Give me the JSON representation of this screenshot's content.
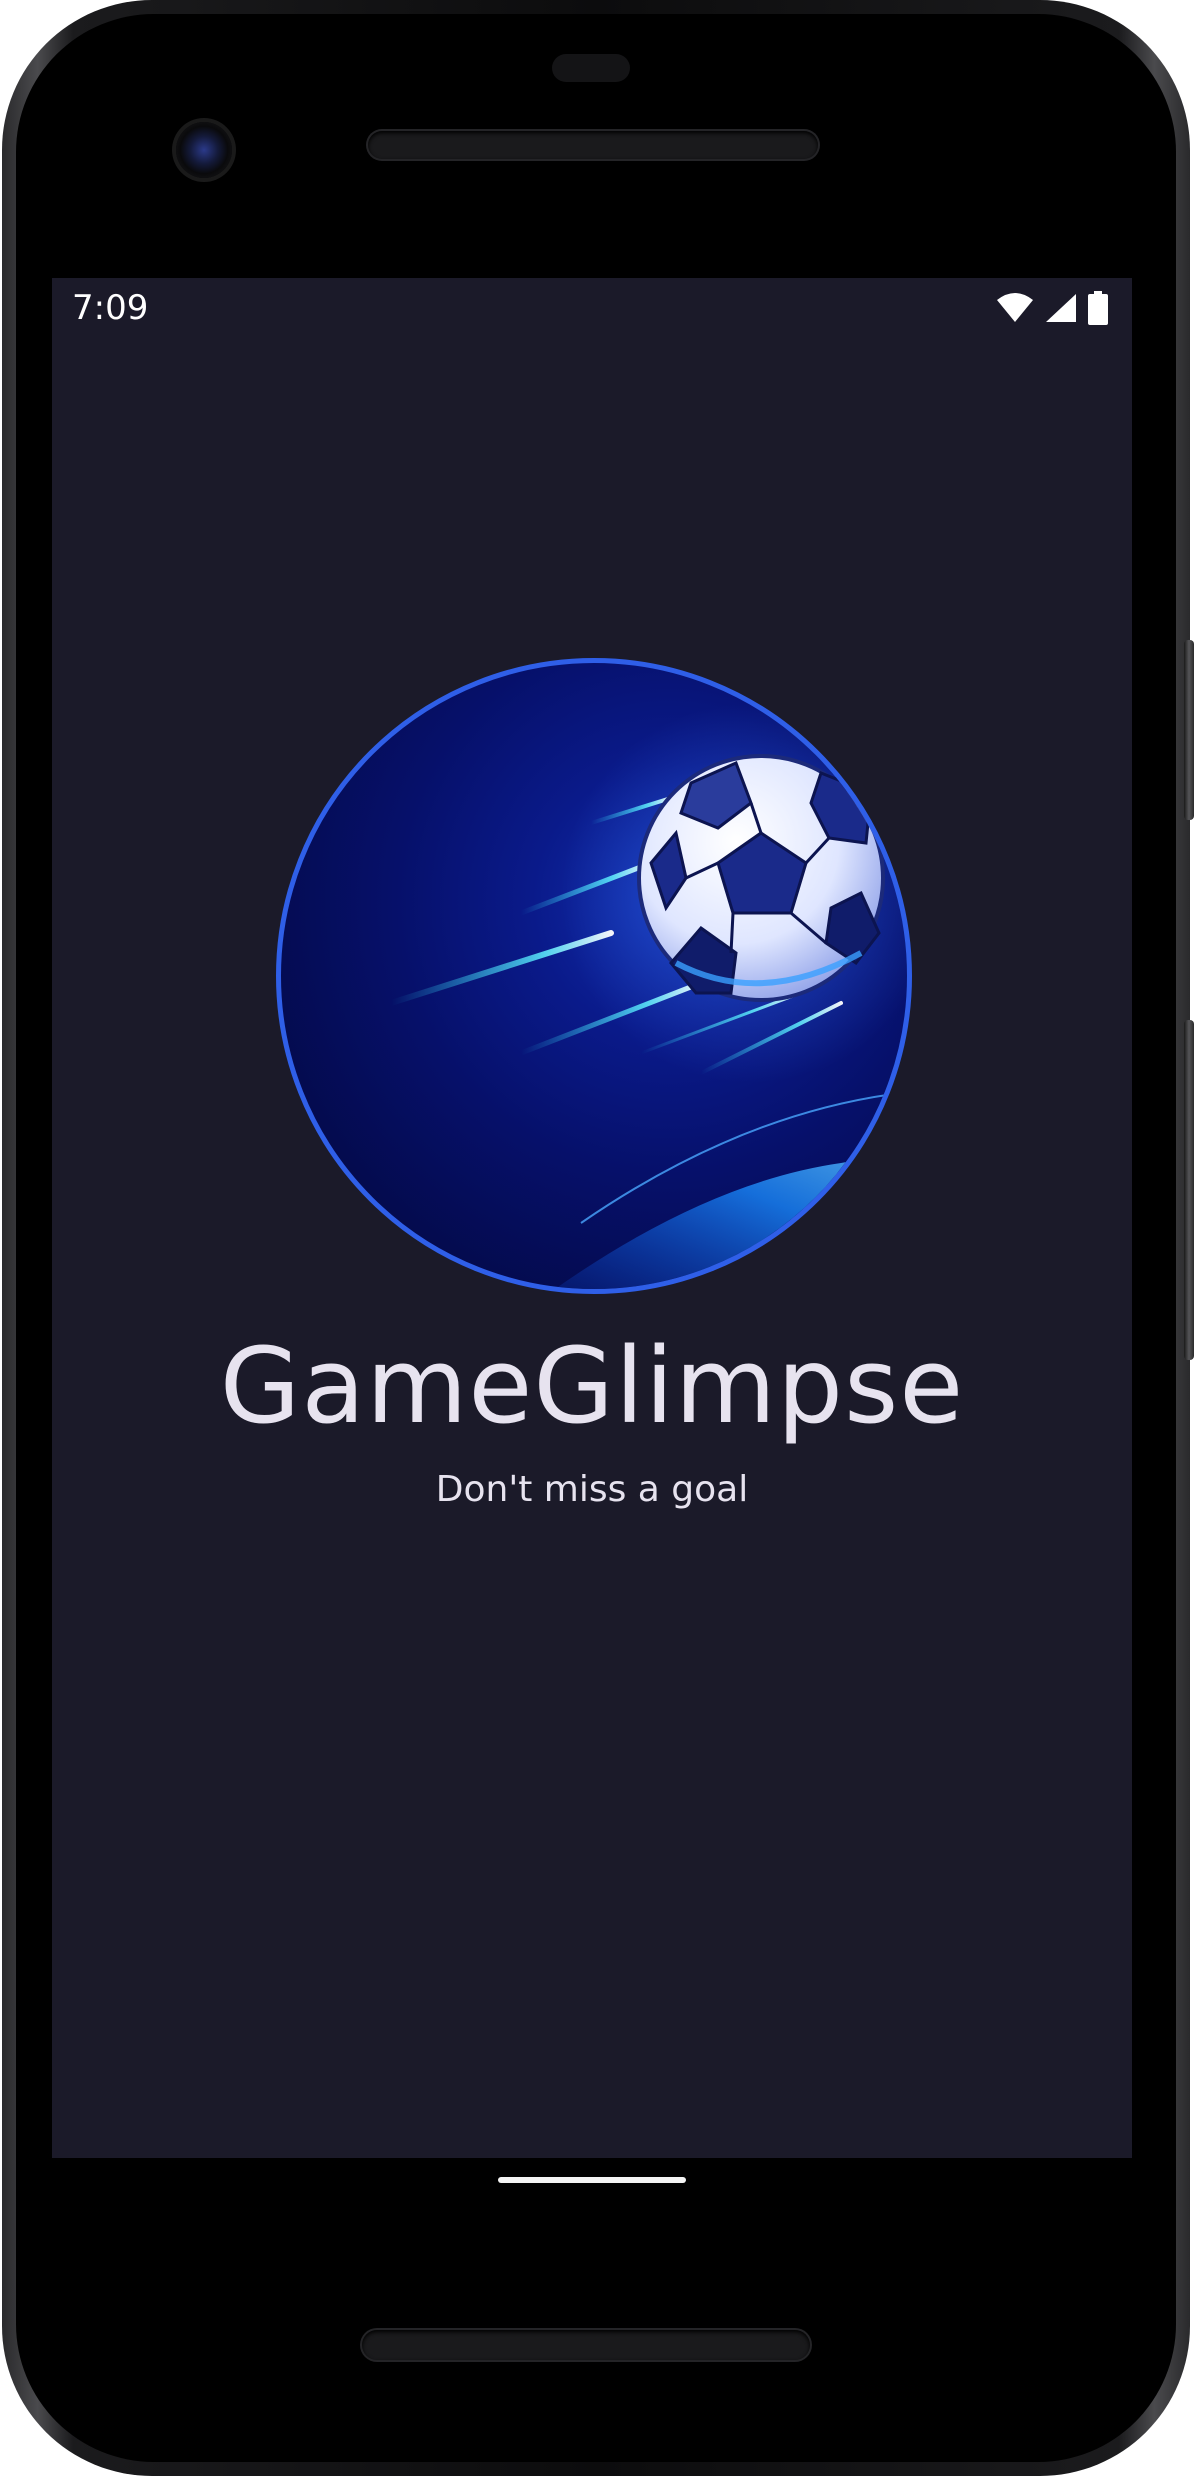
{
  "status_bar": {
    "time": "7:09",
    "icons": [
      "wifi-icon",
      "cellular-signal-icon",
      "battery-icon"
    ]
  },
  "splash": {
    "logo": "soccer-ball-logo",
    "title": "GameGlimpse",
    "subtitle": "Don't miss a goal"
  },
  "colors": {
    "screen_background": "#1b1a29",
    "logo_ring": "#2f5fe8",
    "text": "#e7e3ef"
  }
}
